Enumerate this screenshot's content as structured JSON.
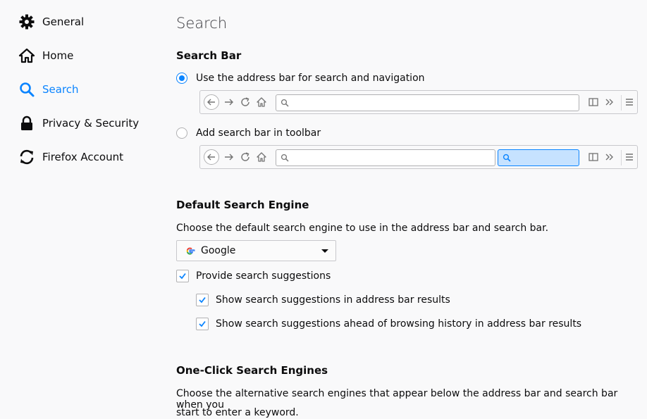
{
  "sidebar": {
    "items": [
      {
        "label": "General",
        "icon": "gear-icon"
      },
      {
        "label": "Home",
        "icon": "home-icon"
      },
      {
        "label": "Search",
        "icon": "search-icon",
        "selected": true
      },
      {
        "label": "Privacy & Security",
        "icon": "lock-icon"
      },
      {
        "label": "Firefox Account",
        "icon": "sync-icon"
      }
    ]
  },
  "page": {
    "title": "Search"
  },
  "search_bar": {
    "heading": "Search Bar",
    "option_address_bar": {
      "label": "Use the address bar for search and navigation",
      "selected": true
    },
    "option_toolbar": {
      "label": "Add search bar in toolbar",
      "selected": false
    }
  },
  "default_engine": {
    "heading": "Default Search Engine",
    "description": "Choose the default search engine to use in the address bar and search bar.",
    "selected_engine": "Google",
    "suggestions": {
      "label": "Provide search suggestions",
      "checked": true
    },
    "address_bar_results": {
      "label": "Show search suggestions in address bar results",
      "checked": true
    },
    "ahead_of_history": {
      "label": "Show search suggestions ahead of browsing history in address bar results",
      "checked": true
    }
  },
  "one_click": {
    "heading": "One-Click Search Engines",
    "description_line1": "Choose the alternative search engines that appear below the address bar and search bar when you",
    "description_line2": "start to enter a keyword."
  },
  "colors": {
    "accent": "#0a84ff",
    "background": "#f9f9fa"
  }
}
